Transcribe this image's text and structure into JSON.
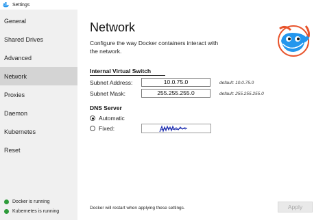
{
  "window": {
    "title": "Settings"
  },
  "sidebar": {
    "items": [
      {
        "label": "General"
      },
      {
        "label": "Shared Drives"
      },
      {
        "label": "Advanced"
      },
      {
        "label": "Network",
        "active": true
      },
      {
        "label": "Proxies"
      },
      {
        "label": "Daemon"
      },
      {
        "label": "Kubernetes"
      },
      {
        "label": "Reset"
      }
    ],
    "status": [
      {
        "label": "Docker is running",
        "color": "#2e9b3a"
      },
      {
        "label": "Kubernetes is running",
        "color": "#2e9b3a"
      }
    ]
  },
  "main": {
    "title": "Network",
    "description": "Configure the way Docker containers interact with the network.",
    "switch_section": {
      "heading": "Internal Virtual Switch",
      "subnet_address_label": "Subnet Address:",
      "subnet_address_value": "10.0.75.0",
      "subnet_address_default": "default: 10.0.75.0",
      "subnet_mask_label": "Subnet Mask:",
      "subnet_mask_value": "255.255.255.0",
      "subnet_mask_default": "default: 255.255.255.0"
    },
    "dns_section": {
      "heading": "DNS Server",
      "automatic_label": "Automatic",
      "fixed_label": "Fixed:",
      "selected": "Automatic"
    },
    "footer_note": "Docker will restart when applying these settings.",
    "apply_label": "Apply"
  },
  "colors": {
    "status_green": "#2e9b3a",
    "whale_blue": "#2496ed",
    "scribble_blue": "#1f2fb0"
  }
}
